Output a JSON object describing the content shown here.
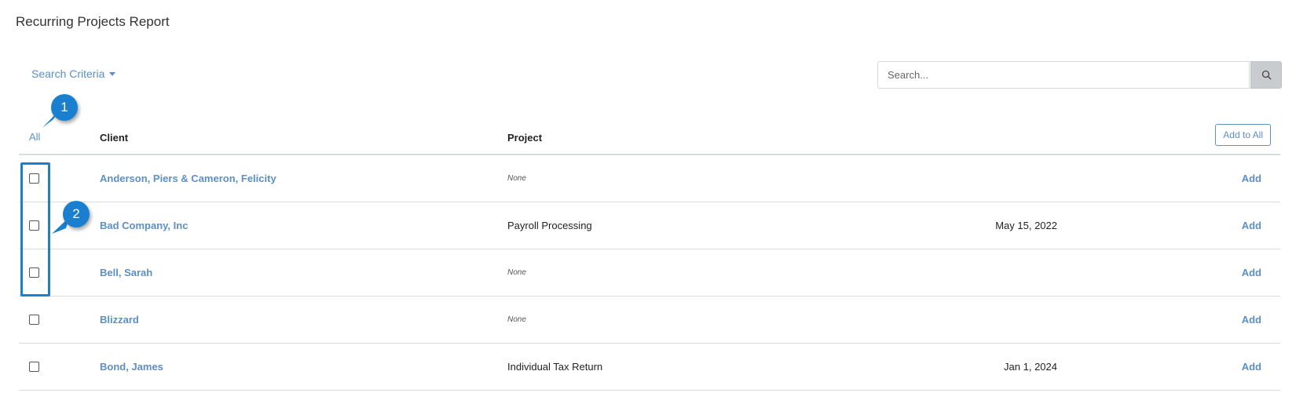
{
  "header": {
    "title": "Recurring Projects Report"
  },
  "toolbar": {
    "search_criteria_label": "Search Criteria",
    "search_placeholder": "Search...",
    "search_value": ""
  },
  "table": {
    "select_all_label": "All",
    "columns": {
      "client": "Client",
      "project": "Project"
    },
    "add_all_label": "Add to All",
    "rows": [
      {
        "client": "Anderson, Piers & Cameron, Felicity",
        "project": "None",
        "project_is_none": true,
        "date": "",
        "action": "Add"
      },
      {
        "client": "Bad Company, Inc",
        "project": "Payroll Processing",
        "project_is_none": false,
        "date": "May 15, 2022",
        "action": "Add"
      },
      {
        "client": "Bell, Sarah",
        "project": "None",
        "project_is_none": true,
        "date": "",
        "action": "Add"
      },
      {
        "client": "Blizzard",
        "project": "None",
        "project_is_none": true,
        "date": "",
        "action": "Add"
      },
      {
        "client": "Bond, James",
        "project": "Individual Tax Return",
        "project_is_none": false,
        "date": "Jan 1, 2024",
        "action": "Add"
      }
    ]
  },
  "callouts": {
    "one": "1",
    "two": "2"
  },
  "colors": {
    "link": "#5b8fc7",
    "callout": "#1a7fcf",
    "divider": "#d9dcdf"
  }
}
